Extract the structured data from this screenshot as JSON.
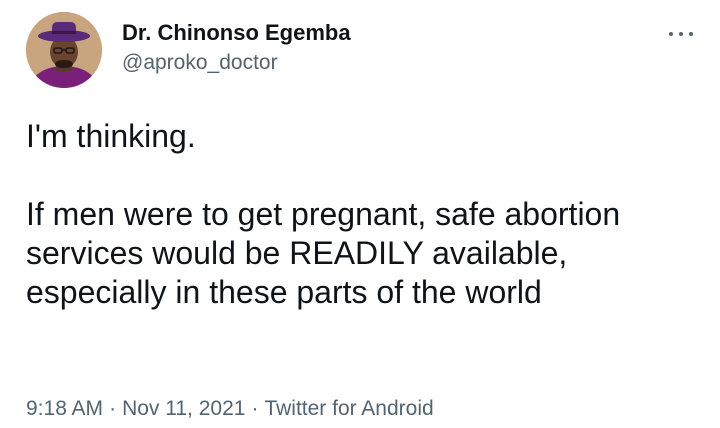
{
  "author": {
    "display_name": "Dr. Chinonso Egemba",
    "handle": "@aproko_doctor",
    "avatar_icon": "profile-photo"
  },
  "more_icon": "more-horizontal-icon",
  "tweet": {
    "paragraphs": [
      "I'm thinking.",
      "If men were to get pregnant, safe abortion services would be READILY available, especially in these parts of the world"
    ]
  },
  "meta": {
    "time": "9:18 AM",
    "separator": "·",
    "date": "Nov 11, 2021",
    "source": "Twitter for Android"
  },
  "colors": {
    "text": "#0f1419",
    "secondary": "#536471",
    "background": "#ffffff"
  }
}
